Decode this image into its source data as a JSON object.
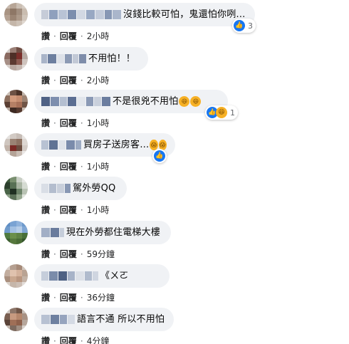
{
  "comments": [
    {
      "text": "沒錢比較可怕，鬼還怕你咧…",
      "action_like": "讚",
      "action_reply": "回覆",
      "dot": "·",
      "time": "2小時",
      "reaction_count": "3",
      "reaction_icons": [
        "like-icon"
      ]
    },
    {
      "text": "不用怕！！",
      "action_like": "讚",
      "action_reply": "回覆",
      "dot": "·",
      "time": "2小時"
    },
    {
      "text": "不是很兇不用怕",
      "action_like": "讚",
      "action_reply": "回覆",
      "dot": "·",
      "time": "1小時",
      "reaction_count": "1",
      "reaction_icons": [
        "like-icon",
        "haha-icon"
      ],
      "inline_emoji": [
        "laughing-emoji",
        "laughing-emoji"
      ]
    },
    {
      "text": "買房子送房客…",
      "action_like": "讚",
      "action_reply": "回覆",
      "dot": "·",
      "time": "1小時",
      "inline_emoji": [
        "scared-emoji",
        "scared-emoji"
      ],
      "reaction_icons": [
        "like-icon"
      ]
    },
    {
      "text": "駕外勞QQ",
      "action_like": "讚",
      "action_reply": "回覆",
      "dot": "·",
      "time": "1小時"
    },
    {
      "text": "現在外勞都住電梯大樓",
      "action_like": "讚",
      "action_reply": "回覆",
      "dot": "·",
      "time": "59分鐘"
    },
    {
      "text": "《ㄨㄛ",
      "action_like": "讚",
      "action_reply": "回覆",
      "dot": "·",
      "time": "36分鐘"
    },
    {
      "text": "語言不通 所以不用怕",
      "action_like": "讚",
      "action_reply": "回覆",
      "dot": "·",
      "time": "4分鐘"
    }
  ]
}
